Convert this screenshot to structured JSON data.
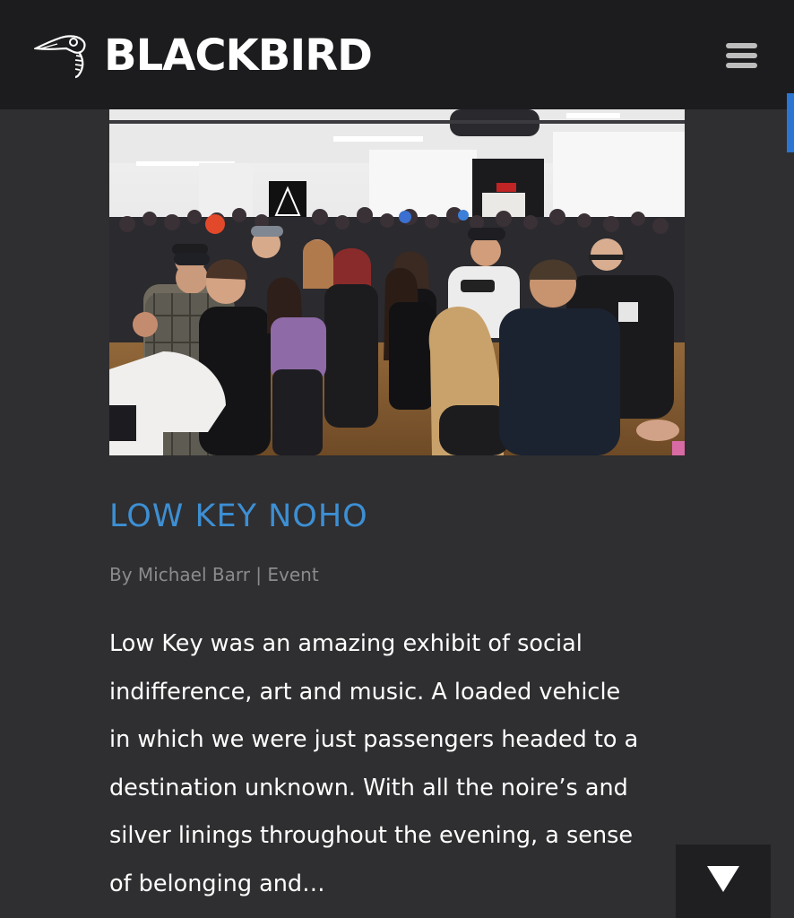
{
  "header": {
    "brand": "BLACKBIRD",
    "logo_icon": "crow-skull-icon",
    "menu_icon": "hamburger-menu-icon"
  },
  "post": {
    "image_description_icon": "event-crowd-photo",
    "title": "LOW KEY NOHO",
    "meta": {
      "by_prefix": "By ",
      "author": "Michael Barr",
      "separator": " | ",
      "category": "Event"
    },
    "excerpt_lines": [
      "Low Key was an amazing exhibit of social",
      "indifference, art and music. A loaded vehicle",
      "in which we were just passengers headed to a",
      "destination unknown. With all the noire’s and",
      "silver linings throughout the evening, a sense",
      "of belonging and…"
    ]
  },
  "controls": {
    "scroll_down_icon": "triangle-down-icon"
  },
  "colors": {
    "header_bg": "#1c1b1d",
    "page_bg": "#2f2e30",
    "accent": "#3d8fd3",
    "meta_text": "#8b8a8c",
    "scrollbar": "#2a76d2"
  }
}
